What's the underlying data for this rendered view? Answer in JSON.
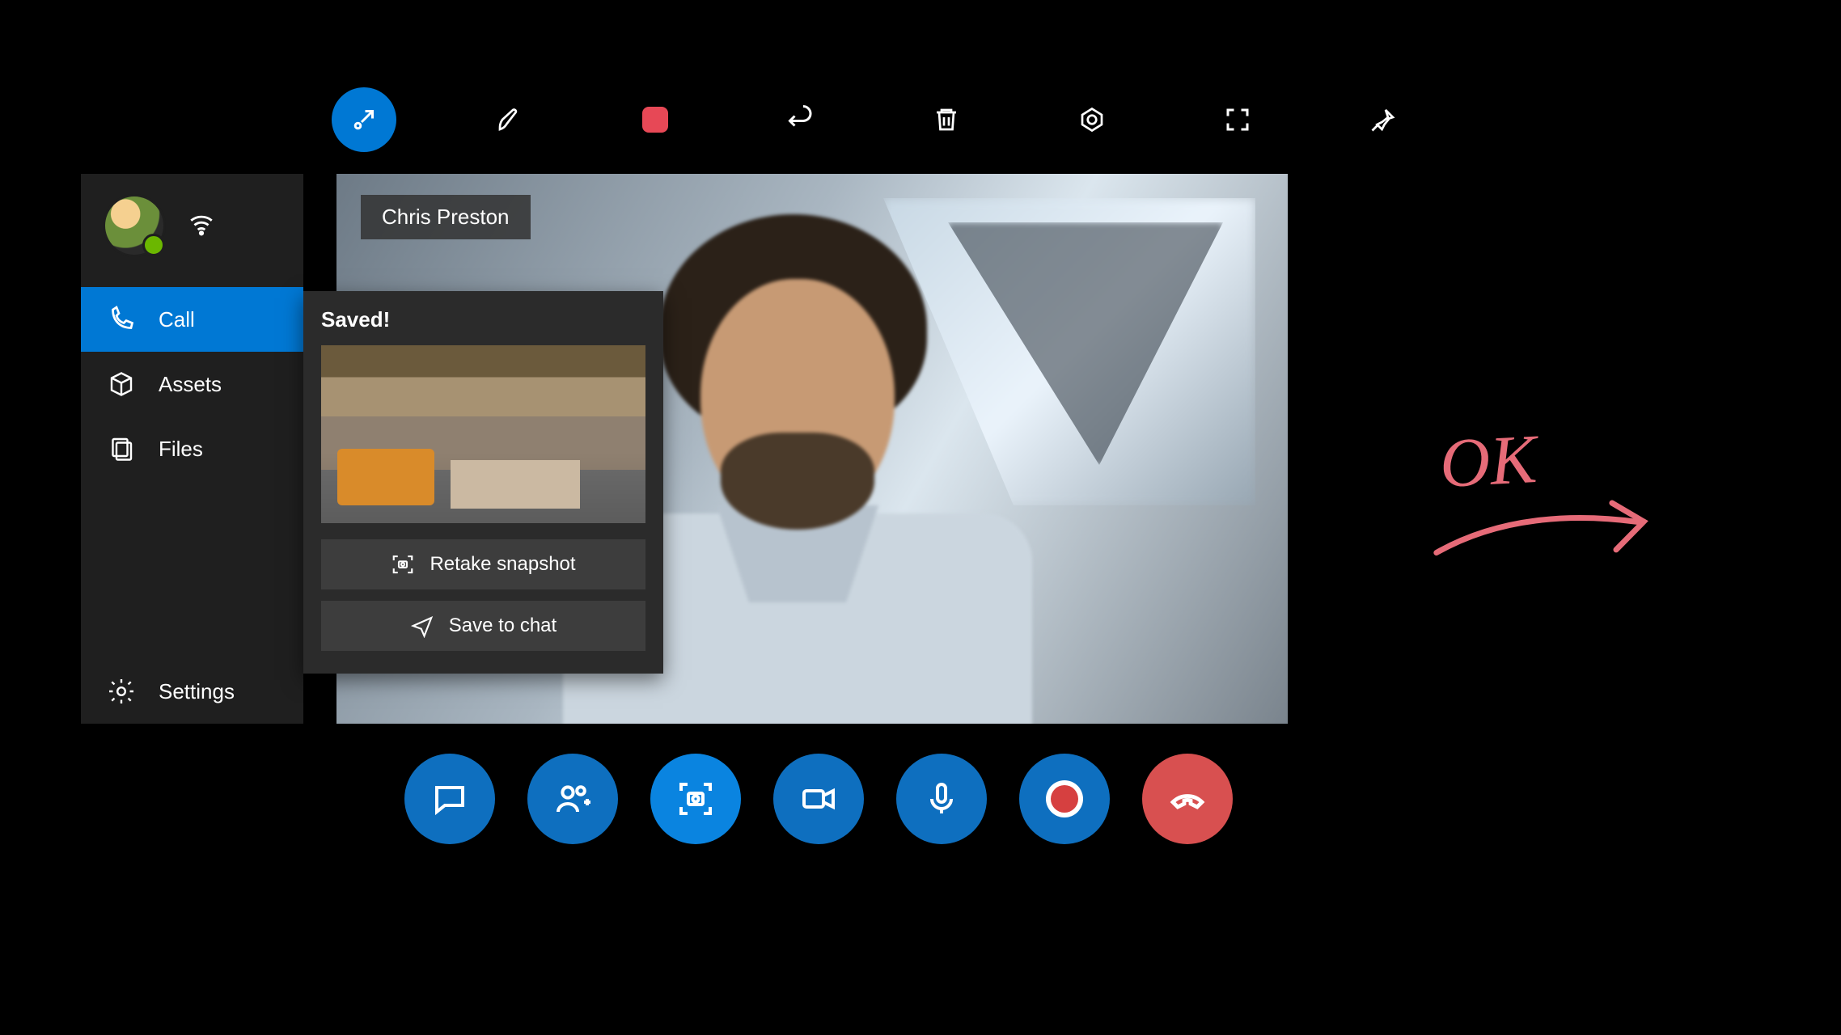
{
  "participant": {
    "name": "Chris Preston"
  },
  "sidebar": {
    "items": [
      {
        "label": "Call"
      },
      {
        "label": "Assets"
      },
      {
        "label": "Files"
      },
      {
        "label": "Settings"
      }
    ]
  },
  "snapshot": {
    "status": "Saved!",
    "retake_label": "Retake snapshot",
    "save_label": "Save to chat"
  },
  "toolbar": {
    "collapse": "collapse-icon",
    "ink": "pen-icon",
    "stop": "stop-icon",
    "undo": "undo-icon",
    "delete": "trash-icon",
    "target": "target-icon",
    "fullscreen": "expand-icon",
    "pin": "pin-icon"
  },
  "controls": {
    "chat": "chat-icon",
    "add_people": "add-people-icon",
    "snapshot": "snapshot-icon",
    "video": "video-icon",
    "mic": "mic-icon",
    "record": "record-icon",
    "hangup": "hangup-icon"
  },
  "annotation": {
    "text": "OK"
  },
  "colors": {
    "accent": "#0078d4",
    "hangup": "#d85050",
    "ink": "#e66b78"
  }
}
